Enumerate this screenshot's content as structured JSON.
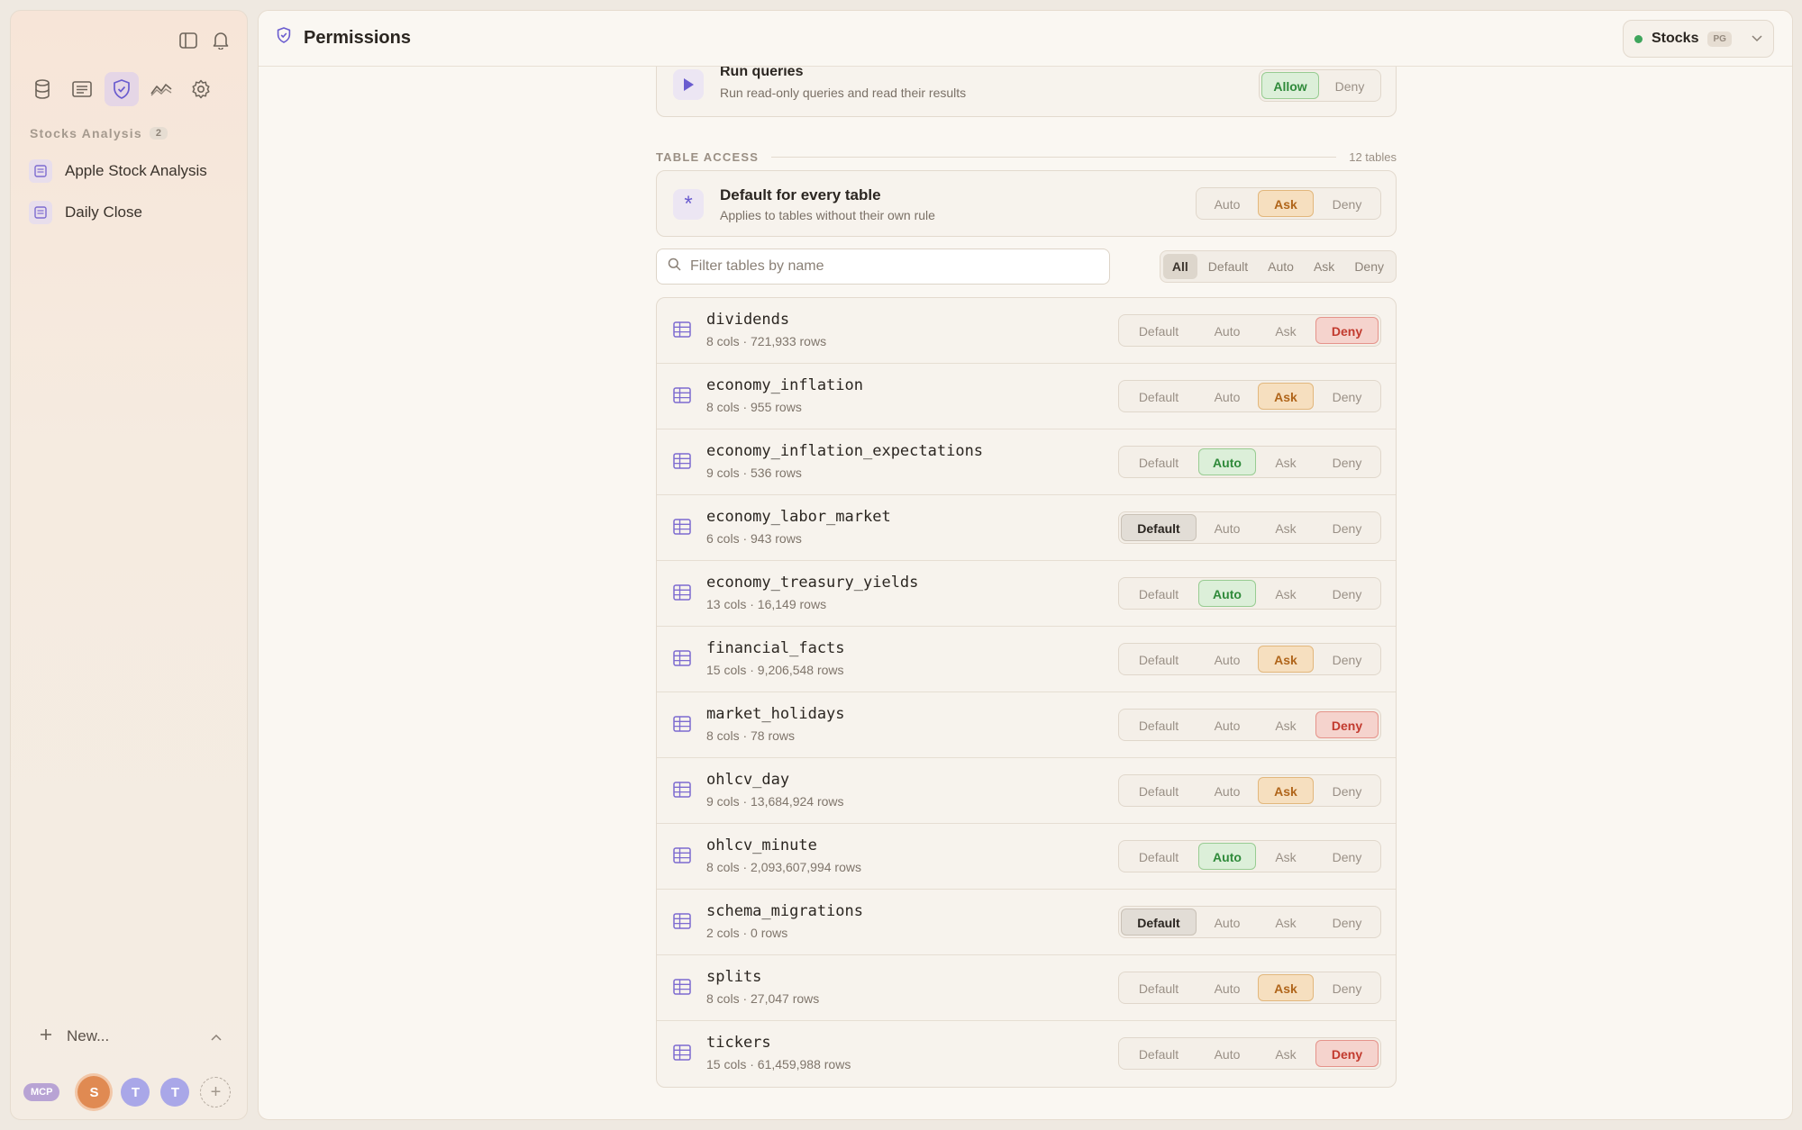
{
  "sidebar": {
    "section_title": "Stocks Analysis",
    "section_count": "2",
    "items": [
      {
        "label": "Apple Stock Analysis"
      },
      {
        "label": "Daily Close"
      }
    ],
    "new_label": "New...",
    "mcp_label": "MCP",
    "avatars": [
      "S",
      "T",
      "T"
    ],
    "add_avatar": "+"
  },
  "header": {
    "title": "Permissions",
    "db_name": "Stocks",
    "db_tag": "PG"
  },
  "query_card": {
    "title": "Run queries",
    "subtitle": "Run read-only queries and read their results",
    "options": [
      "Allow",
      "Deny"
    ],
    "selected": "Allow"
  },
  "table_access": {
    "heading": "TABLE ACCESS",
    "count": "12 tables",
    "default_card": {
      "icon": "*",
      "title": "Default for every table",
      "subtitle": "Applies to tables without their own rule",
      "options": [
        "Auto",
        "Ask",
        "Deny"
      ],
      "selected": "Ask"
    },
    "search_placeholder": "Filter tables by name",
    "filters": [
      "All",
      "Default",
      "Auto",
      "Ask",
      "Deny"
    ],
    "active_filter": "All",
    "row_options": [
      "Default",
      "Auto",
      "Ask",
      "Deny"
    ],
    "tables": [
      {
        "name": "dividends",
        "meta": "8 cols · 721,933 rows",
        "selected": "Deny"
      },
      {
        "name": "economy_inflation",
        "meta": "8 cols · 955 rows",
        "selected": "Ask"
      },
      {
        "name": "economy_inflation_expectations",
        "meta": "9 cols · 536 rows",
        "selected": "Auto"
      },
      {
        "name": "economy_labor_market",
        "meta": "6 cols · 943 rows",
        "selected": "Default"
      },
      {
        "name": "economy_treasury_yields",
        "meta": "13 cols · 16,149 rows",
        "selected": "Auto"
      },
      {
        "name": "financial_facts",
        "meta": "15 cols · 9,206,548 rows",
        "selected": "Ask"
      },
      {
        "name": "market_holidays",
        "meta": "8 cols · 78 rows",
        "selected": "Deny"
      },
      {
        "name": "ohlcv_day",
        "meta": "9 cols · 13,684,924 rows",
        "selected": "Ask"
      },
      {
        "name": "ohlcv_minute",
        "meta": "8 cols · 2,093,607,994 rows",
        "selected": "Auto"
      },
      {
        "name": "schema_migrations",
        "meta": "2 cols · 0 rows",
        "selected": "Default"
      },
      {
        "name": "splits",
        "meta": "8 cols · 27,047 rows",
        "selected": "Ask"
      },
      {
        "name": "tickers",
        "meta": "15 cols · 61,459,988 rows",
        "selected": "Deny"
      }
    ]
  },
  "colors": {
    "accent": "#6a5ccf",
    "auto_green": "#2f8a3a",
    "ask_orange": "#b0651a",
    "deny_red": "#c23a2e",
    "status_green": "#3fa55c"
  }
}
